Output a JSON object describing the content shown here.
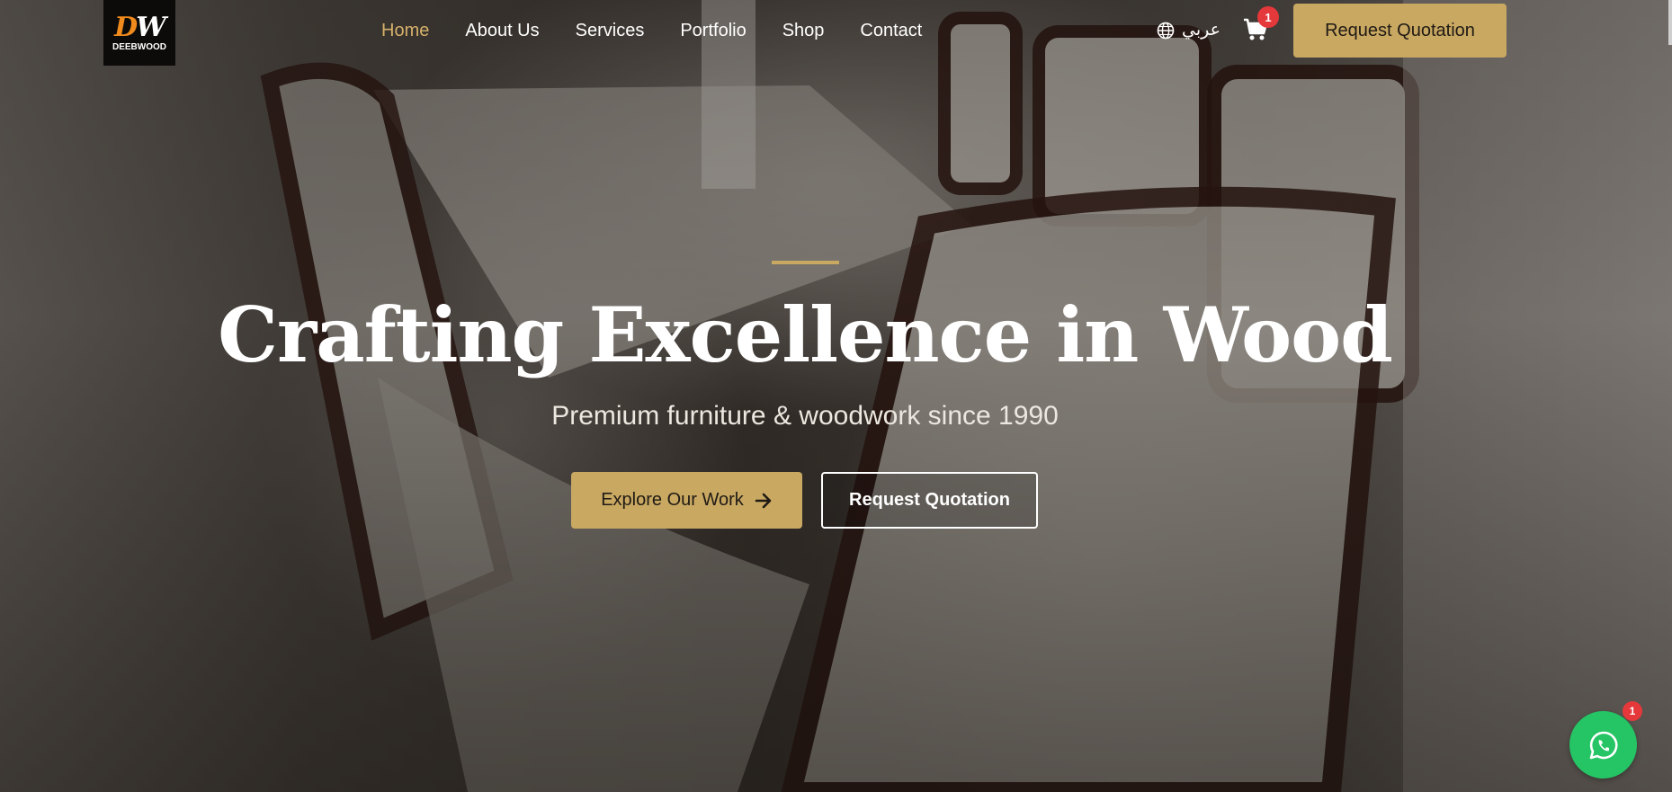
{
  "brand": {
    "logo_mark_a": "D",
    "logo_mark_b": "W",
    "logo_name": "DEEBWOOD"
  },
  "nav": {
    "items": [
      {
        "label": "Home",
        "active": true
      },
      {
        "label": "About Us"
      },
      {
        "label": "Services"
      },
      {
        "label": "Portfolio"
      },
      {
        "label": "Shop"
      },
      {
        "label": "Contact"
      }
    ]
  },
  "header": {
    "language_label": "عربي",
    "language_icon": "globe-icon",
    "cart_icon": "cart-icon",
    "cart_count": "1",
    "cta_label": "Request Quotation"
  },
  "hero": {
    "title": "Crafting Excellence in Wood",
    "subtitle": "Premium furniture & woodwork since 1990",
    "primary_button": "Explore Our Work",
    "primary_button_icon": "arrow-right-icon",
    "secondary_button": "Request Quotation"
  },
  "whatsapp": {
    "icon": "whatsapp-icon",
    "badge_count": "1"
  },
  "colors": {
    "accent": "#c9a862",
    "badge": "#e5383b",
    "whatsapp": "#25c464",
    "nav_active": "#d5b06b"
  }
}
